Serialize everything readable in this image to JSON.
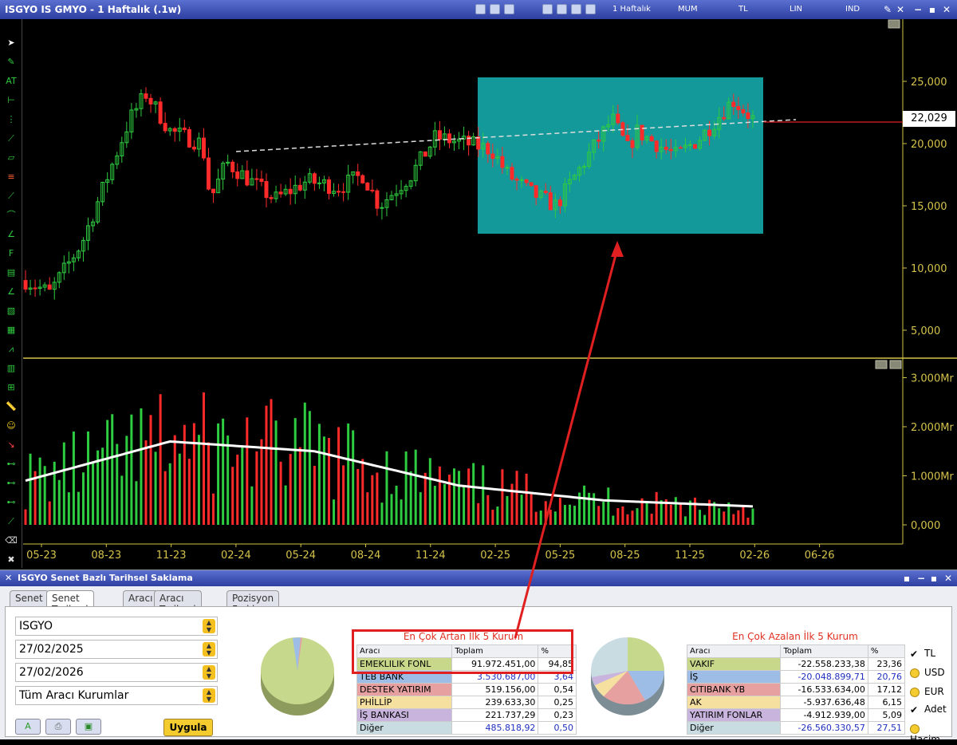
{
  "window": {
    "title": "ISGYO IS GMYO - 1 Haftalık (.1w)",
    "period": "1 Haftalık",
    "chart_type": "MUM",
    "currency": "TL",
    "scale": "LIN",
    "indicator": "IND"
  },
  "price_axis": {
    "ticks": [
      "25,000",
      "20,000",
      "15,000",
      "10,000",
      "5,000"
    ],
    "current": "22,029"
  },
  "volume_axis": {
    "ticks": [
      "3.000Mr",
      "2.000Mr",
      "1.000Mr",
      "0,000"
    ]
  },
  "time_axis": {
    "ticks": [
      "05-23",
      "08-23",
      "11-23",
      "02-24",
      "05-24",
      "08-24",
      "11-24",
      "02-25",
      "05-25",
      "08-25",
      "11-25",
      "02-26",
      "06-26"
    ]
  },
  "colors": {
    "bull": "#2ecc40",
    "bear": "#ff2a2a",
    "highlight": "#13999a",
    "axis": "#d4c24a"
  },
  "panel": {
    "title": "ISGYO Senet Bazlı Tarihsel Saklama",
    "tabs": [
      "Senet",
      "Senet Tarihsel",
      "Aracı",
      "Aracı Tarihsel",
      "Pozisyon Farkları"
    ],
    "symbol": "ISGYO",
    "date_from": "27/02/2025",
    "date_to": "27/02/2026",
    "broker_filter": "Tüm Aracı Kurumlar",
    "apply_label": "Uygula",
    "top_increase": {
      "title": "En Çok Artan İlk 5 Kurum",
      "headers": [
        "Aracı",
        "Toplam",
        "%"
      ],
      "rows": [
        {
          "name": "EMEKLILIK FONL",
          "total": "91.972.451,00",
          "pct": "94,85",
          "color": "#c8d88a"
        },
        {
          "name": "TEB BANK",
          "total": "3.530.687,00",
          "pct": "3,64",
          "color": "#9dbde6"
        },
        {
          "name": "DESTEK YATIRIM",
          "total": "519.156,00",
          "pct": "0,54",
          "color": "#e6a0a0"
        },
        {
          "name": "PHİLLİP",
          "total": "239.633,30",
          "pct": "0,25",
          "color": "#f6e0a0"
        },
        {
          "name": "İŞ BANKASI",
          "total": "221.737,29",
          "pct": "0,23",
          "color": "#c8b4dc"
        },
        {
          "name": "Diğer",
          "total": "485.818,92",
          "pct": "0,50",
          "color": "#c8dce2"
        }
      ]
    },
    "top_decrease": {
      "title": "En Çok Azalan İlk 5 Kurum",
      "headers": [
        "Aracı",
        "Toplam",
        "%"
      ],
      "rows": [
        {
          "name": "VAKIF",
          "total": "-22.558.233,38",
          "pct": "23,36",
          "color": "#c8d88a"
        },
        {
          "name": "İŞ",
          "total": "-20.048.899,71",
          "pct": "20,76",
          "color": "#9dbde6"
        },
        {
          "name": "CITIBANK YB",
          "total": "-16.533.634,00",
          "pct": "17,12",
          "color": "#e6a0a0"
        },
        {
          "name": "AK",
          "total": "-5.937.636,48",
          "pct": "6,15",
          "color": "#f6e0a0"
        },
        {
          "name": "YATIRIM FONLAR",
          "total": "-4.912.939,00",
          "pct": "5,09",
          "color": "#c8b4dc"
        },
        {
          "name": "Diğer",
          "total": "-26.560.330,57",
          "pct": "27,51",
          "color": "#c8dce2"
        }
      ]
    },
    "options": [
      {
        "label": "TL",
        "selected": true,
        "type": "check"
      },
      {
        "label": "USD",
        "selected": false,
        "type": "radio"
      },
      {
        "label": "EUR",
        "selected": false,
        "type": "radio"
      },
      {
        "label": "Adet",
        "selected": true,
        "type": "check"
      },
      {
        "label": "Hacim",
        "selected": false,
        "type": "radio"
      }
    ]
  }
}
